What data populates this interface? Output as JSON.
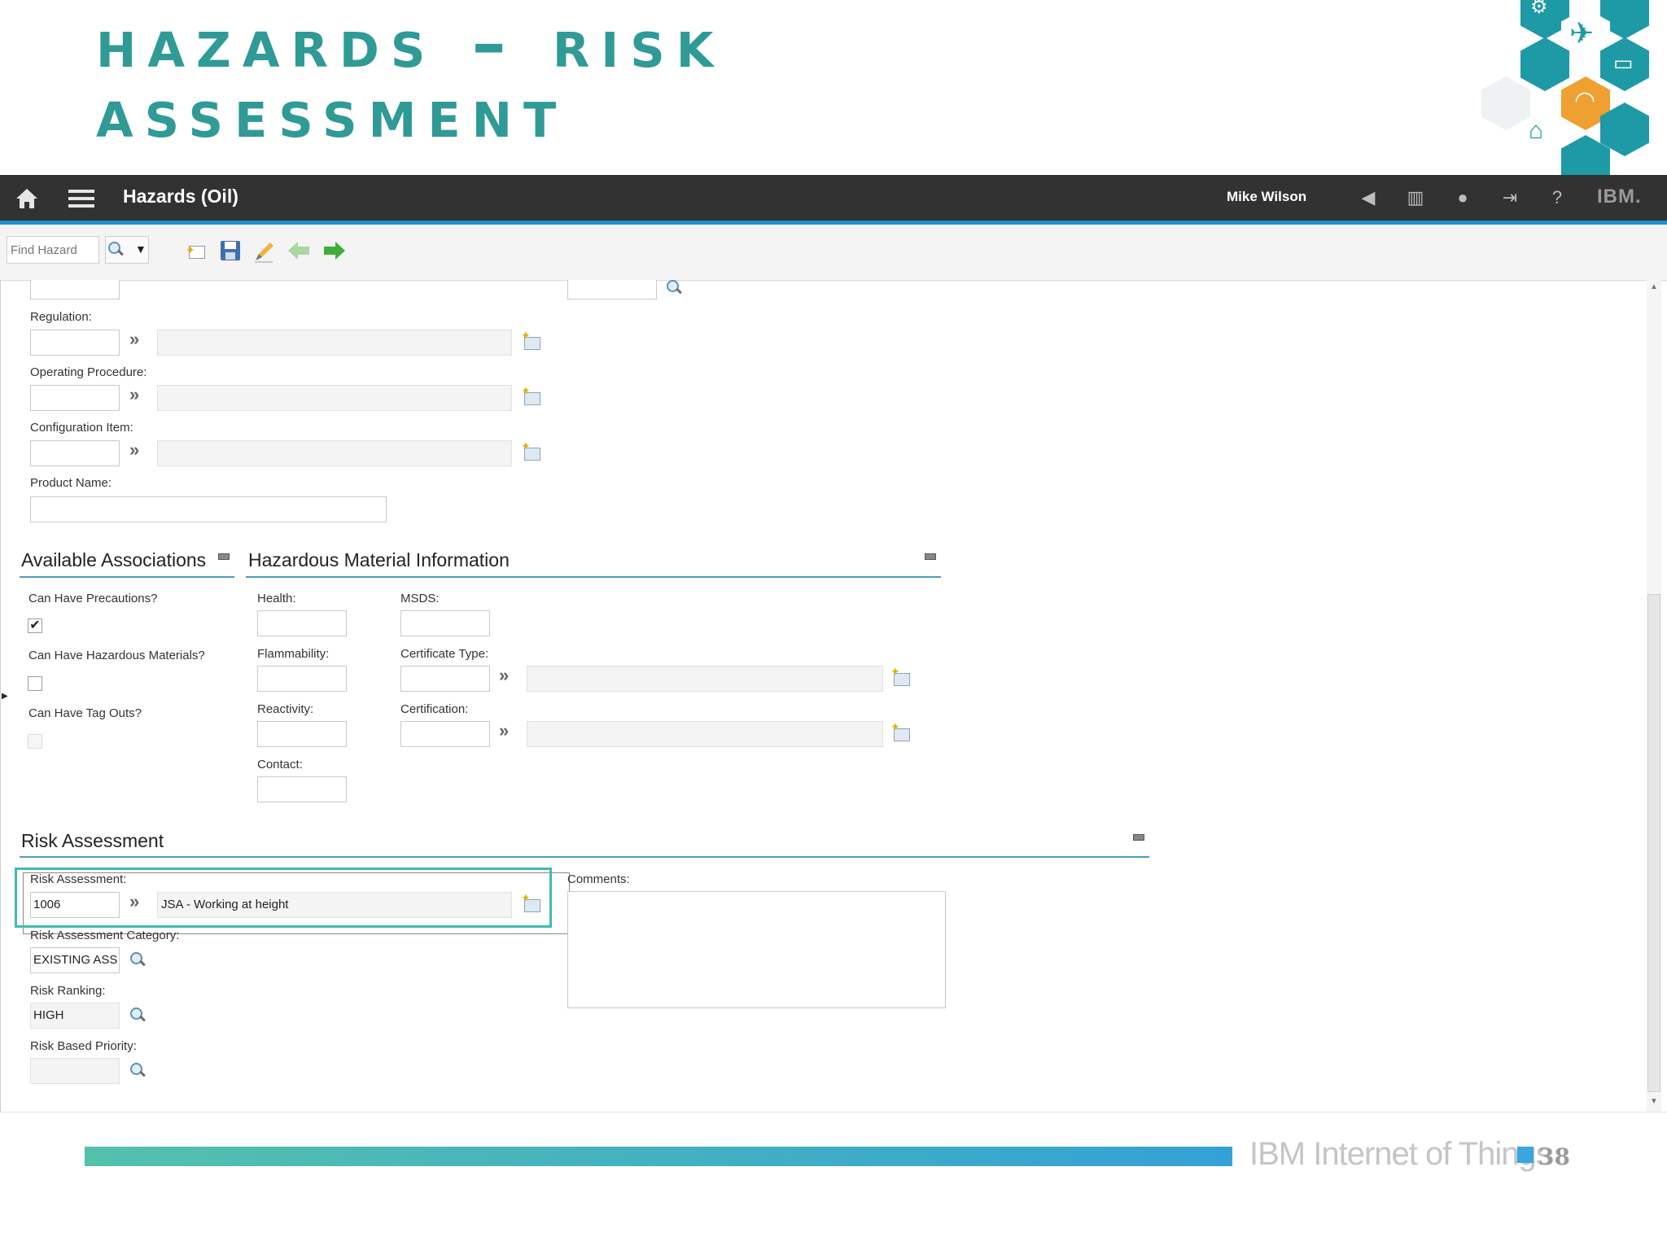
{
  "slide": {
    "title_line1": "Hazards – Risk",
    "title_line2": "Assessment"
  },
  "header": {
    "app_title": "Hazards (Oil)",
    "user": "Mike Wilson",
    "brand": "IBM."
  },
  "toolbar": {
    "find_placeholder": "Find Hazard"
  },
  "form": {
    "regulation_label": "Regulation:",
    "operating_procedure_label": "Operating Procedure:",
    "configuration_item_label": "Configuration Item:",
    "product_name_label": "Product Name:"
  },
  "associations": {
    "title": "Available Associations",
    "precautions_label": "Can Have Precautions?",
    "precautions_checked": true,
    "hazmat_label": "Can Have Hazardous Materials?",
    "tagouts_label": "Can Have Tag Outs?",
    "check_mark": "✔"
  },
  "hazmat": {
    "title": "Hazardous Material Information",
    "health_label": "Health:",
    "msds_label": "MSDS:",
    "flammability_label": "Flammability:",
    "certificate_type_label": "Certificate Type:",
    "reactivity_label": "Reactivity:",
    "certification_label": "Certification:",
    "contact_label": "Contact:"
  },
  "risk": {
    "title": "Risk Assessment",
    "assessment_label": "Risk Assessment:",
    "assessment_value": "1006",
    "assessment_description": "JSA - Working at height",
    "comments_label": "Comments:",
    "category_label": "Risk Assessment Category:",
    "category_value": "EXISTING ASS",
    "ranking_label": "Risk Ranking:",
    "ranking_value": "HIGH",
    "priority_label": "Risk Based Priority:"
  },
  "footer": {
    "brand": "IBM Internet of Things",
    "page": "38"
  },
  "colors": {
    "title_teal": "#2f9a96",
    "header_dark": "#323232",
    "accent_blue": "#1f8fcf",
    "highlight_teal": "#40bab2"
  }
}
